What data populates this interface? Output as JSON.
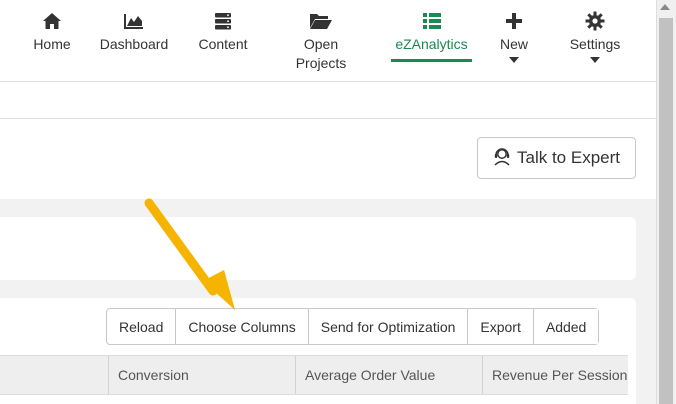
{
  "nav": {
    "items": [
      {
        "label": "Home",
        "icon": "home-icon"
      },
      {
        "label": "Dashboard",
        "icon": "area-chart-icon"
      },
      {
        "label": "Content",
        "icon": "server-icon"
      },
      {
        "label": "Open\nProjects",
        "icon": "folder-open-icon"
      },
      {
        "label": "eZAnalytics",
        "icon": "list-icon"
      },
      {
        "label": "New",
        "icon": "plus-icon"
      },
      {
        "label": "Settings",
        "icon": "gear-icon"
      }
    ],
    "active": "eZAnalytics"
  },
  "header": {
    "expert_button_label": "Talk to Expert",
    "expert_icon": "headset-icon"
  },
  "toolbar": {
    "buttons": [
      "Reload",
      "Choose Columns",
      "Send for Optimization",
      "Export",
      "Added"
    ]
  },
  "table": {
    "columns": [
      "",
      "Conversion",
      "Average Order Value",
      "Revenue Per Session"
    ]
  },
  "colors": {
    "accent": "#1a8a52",
    "annotation_arrow": "#f5b400"
  }
}
